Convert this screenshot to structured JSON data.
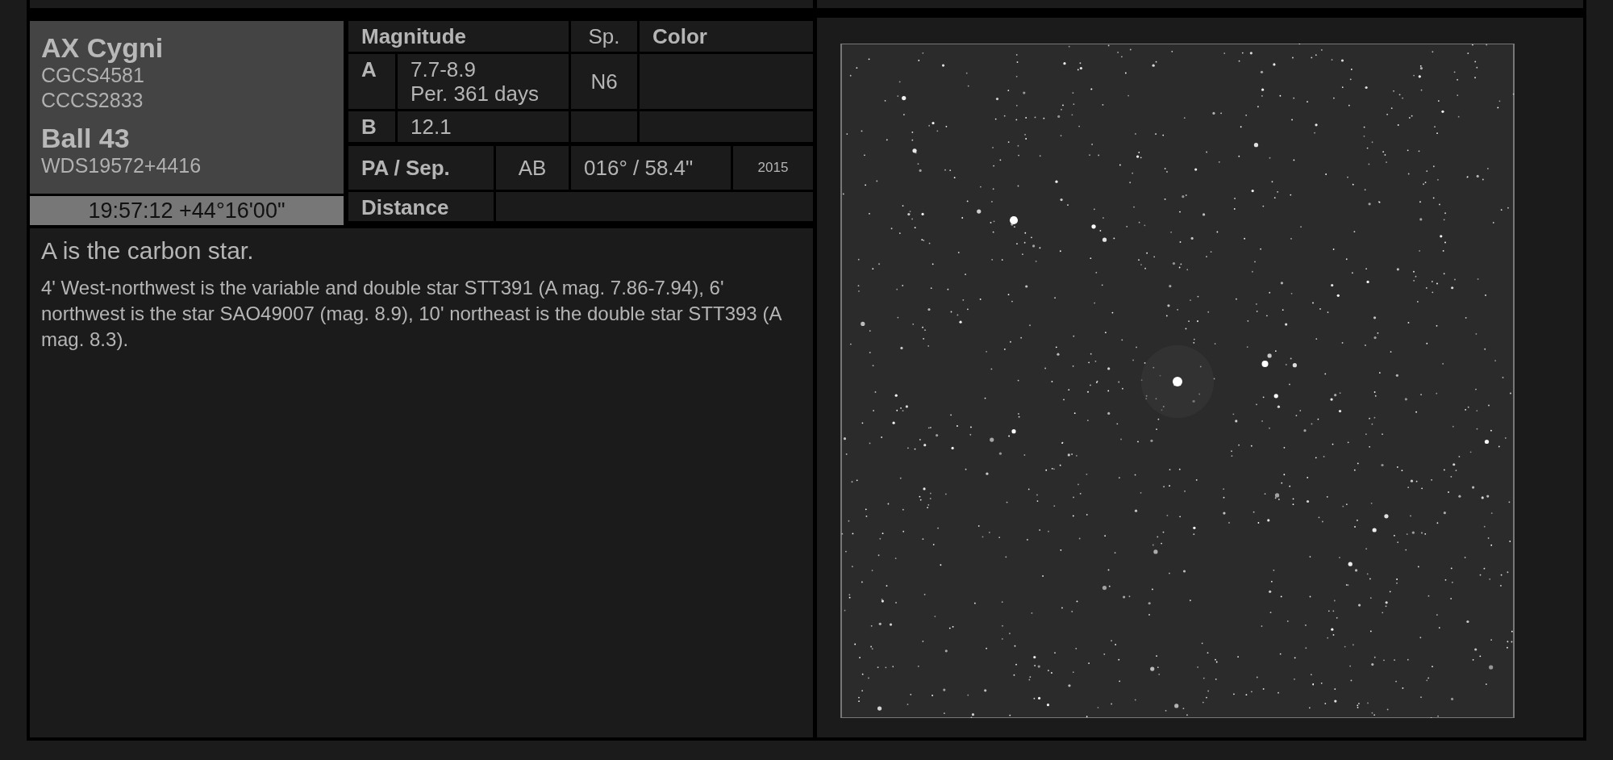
{
  "object": {
    "name": "AX Cygni",
    "designations": [
      "CGCS4581",
      "CCCS2833"
    ],
    "double_name": "Ball 43",
    "wds": "WDS19572+4416",
    "coordinates": "19:57:12 +44°16'00\""
  },
  "components_table": {
    "columns": [
      "Magnitude",
      "Sp.",
      "Color"
    ],
    "rows": [
      {
        "component": "A",
        "magnitude": [
          "7.7-8.9",
          "Per. 361 days"
        ],
        "spectrum": "N6"
      },
      {
        "component": "B",
        "magnitude": [
          "12.1"
        ]
      }
    ]
  },
  "pa_sep": {
    "label": "PA / Sep.",
    "pair": "AB",
    "value": "016° / 58.4\"",
    "year": "2015"
  },
  "distance": {
    "label": "Distance"
  },
  "notes": {
    "headline": "A is the carbon star.",
    "body": "4' West-northwest is the variable and double star STT391 (A mag. 7.86-7.94), 6' northwest is the star SAO49007 (mag. 8.9), 10' northeast is the double star STT393 (A mag. 8.3)."
  }
}
